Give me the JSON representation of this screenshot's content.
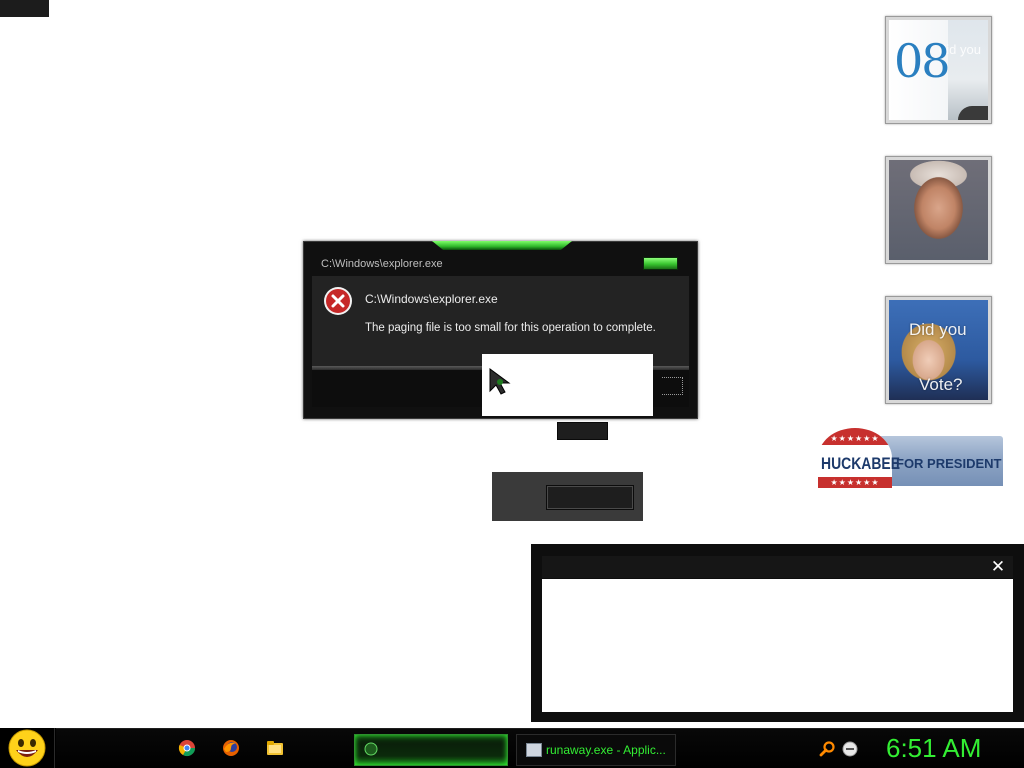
{
  "error_dialog": {
    "title": "C:\\Windows\\explorer.exe",
    "path": "C:\\Windows\\explorer.exe",
    "message": "The paging file is too small for this operation to complete."
  },
  "gadgets": {
    "calendar": {
      "day": "08",
      "ghost_text": "did you"
    },
    "photo2": {
      "caption_top": "Did you",
      "caption_bottom": "Vote?"
    }
  },
  "banner": {
    "name": "HUCKABEE",
    "tagline": "FOR PRESIDENT",
    "stars": "★★★★★★",
    "colors": {
      "red": "#c7302e",
      "navy": "#1d3a6b",
      "blue": "#8ea5c5"
    }
  },
  "blank_window": {
    "close_glyph": "✕"
  },
  "taskbar": {
    "pinned_icons": [
      "chrome-icon",
      "firefox-icon",
      "folder-icon"
    ],
    "active_task_label": "runaway.exe - Applic...",
    "tray_icons": [
      "search-icon",
      "smiley-tray-icon"
    ],
    "clock": "6:51 AM",
    "accent_color": "#33ee33"
  }
}
